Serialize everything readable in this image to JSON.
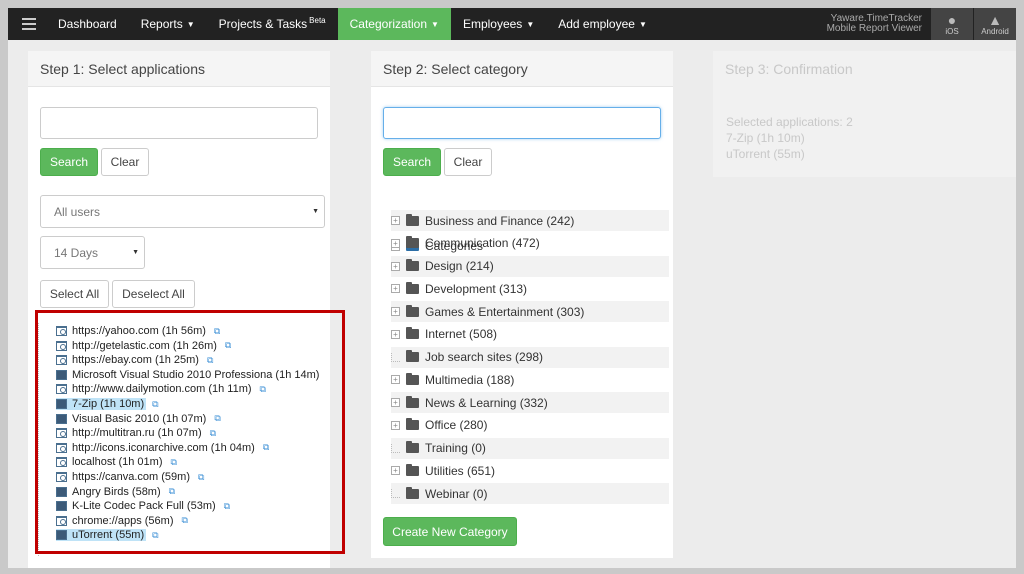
{
  "nav": {
    "items": [
      {
        "label": "Dashboard"
      },
      {
        "label": "Reports"
      },
      {
        "label": "Projects & Tasks",
        "badge": "Beta"
      },
      {
        "label": "Categorization"
      },
      {
        "label": "Employees"
      },
      {
        "label": "Add employee"
      }
    ],
    "mobile_line1": "Yaware.TimeTracker",
    "mobile_line2": "Mobile Report Viewer",
    "ios_label": "iOS",
    "android_label": "Android",
    "active_color": "#5cb85c"
  },
  "step1": {
    "title": "Step 1: Select applications",
    "search_label": "Search",
    "clear_label": "Clear",
    "users_select": "All users",
    "period_select": "14 Days",
    "select_all_label": "Select All",
    "deselect_all_label": "Deselect All",
    "apps": [
      {
        "label": "https://yahoo.com (1h 56m)",
        "icon": "web-icon",
        "selected": false,
        "ext": true
      },
      {
        "label": "http://getelastic.com (1h 26m)",
        "icon": "web-icon",
        "selected": false,
        "ext": true
      },
      {
        "label": "https://ebay.com (1h 25m)",
        "icon": "web-icon",
        "selected": false,
        "ext": true
      },
      {
        "label": "Microsoft Visual Studio 2010 Professiona (1h 14m)",
        "icon": "monitor-icon",
        "selected": false,
        "ext": false
      },
      {
        "label": "http://www.dailymotion.com (1h 11m)",
        "icon": "web-icon",
        "selected": false,
        "ext": true
      },
      {
        "label": "7-Zip (1h 10m)",
        "icon": "monitor-icon",
        "selected": true,
        "ext": true
      },
      {
        "label": "Visual Basic 2010 (1h 07m)",
        "icon": "monitor-icon",
        "selected": false,
        "ext": true
      },
      {
        "label": "http://multitran.ru (1h 07m)",
        "icon": "web-icon",
        "selected": false,
        "ext": true
      },
      {
        "label": "http://icons.iconarchive.com (1h 04m)",
        "icon": "web-icon",
        "selected": false,
        "ext": true
      },
      {
        "label": "localhost (1h 01m)",
        "icon": "web-icon",
        "selected": false,
        "ext": true
      },
      {
        "label": "https://canva.com (59m)",
        "icon": "web-icon",
        "selected": false,
        "ext": true
      },
      {
        "label": "Angry Birds (58m)",
        "icon": "monitor-icon",
        "selected": false,
        "ext": true
      },
      {
        "label": "K-Lite Codec Pack Full (53m)",
        "icon": "monitor-icon",
        "selected": false,
        "ext": true
      },
      {
        "label": "chrome://apps (56m)",
        "icon": "web-icon",
        "selected": false,
        "ext": true
      },
      {
        "label": "uTorrent (55m)",
        "icon": "monitor-icon",
        "selected": true,
        "ext": true
      }
    ]
  },
  "step2": {
    "title": "Step 2: Select category",
    "search_label": "Search",
    "clear_label": "Clear",
    "root_label": "Categories",
    "categories": [
      {
        "label": "Business and Finance (242)",
        "expandable": true
      },
      {
        "label": "Communication (472)",
        "expandable": true
      },
      {
        "label": "Design (214)",
        "expandable": true
      },
      {
        "label": "Development (313)",
        "expandable": true
      },
      {
        "label": "Games & Entertainment (303)",
        "expandable": true
      },
      {
        "label": "Internet (508)",
        "expandable": true
      },
      {
        "label": "Job search sites (298)",
        "expandable": false
      },
      {
        "label": "Multimedia (188)",
        "expandable": true
      },
      {
        "label": "News & Learning (332)",
        "expandable": true
      },
      {
        "label": "Office (280)",
        "expandable": true
      },
      {
        "label": "Training (0)",
        "expandable": false
      },
      {
        "label": "Utilities (651)",
        "expandable": true
      },
      {
        "label": "Webinar (0)",
        "expandable": false
      }
    ],
    "create_label": "Create New Category"
  },
  "step3": {
    "title": "Step 3: Confirmation",
    "selected_summary": "Selected applications: 2",
    "selected_items": [
      "7-Zip (1h 10m)",
      "uTorrent (55m)"
    ]
  }
}
